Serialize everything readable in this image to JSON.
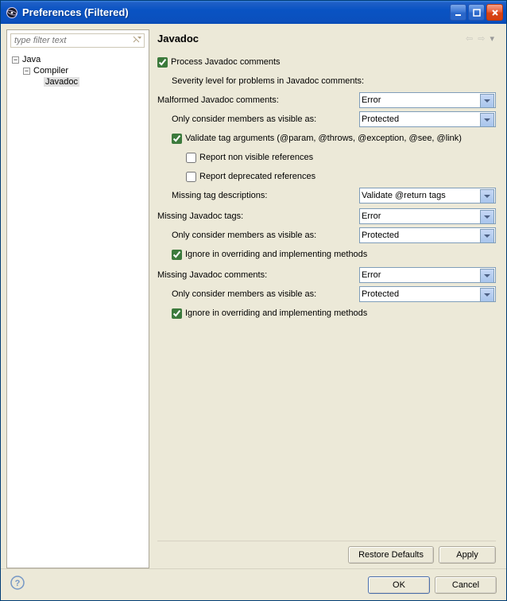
{
  "window": {
    "title": "Preferences (Filtered)"
  },
  "sidebar": {
    "filter_placeholder": "type filter text",
    "tree": {
      "root": "Java",
      "child": "Compiler",
      "leaf": "Javadoc"
    }
  },
  "page": {
    "title": "Javadoc",
    "process_label": "Process Javadoc comments",
    "severity_caption": "Severity level for problems in Javadoc comments:",
    "malformed": {
      "label": "Malformed Javadoc comments:",
      "value": "Error",
      "visibility_label": "Only consider members as visible as:",
      "visibility_value": "Protected",
      "validate_label": "Validate tag arguments (@param, @throws, @exception, @see, @link)",
      "report_nonvisible_label": "Report non visible references",
      "report_deprecated_label": "Report deprecated references",
      "missing_desc_label": "Missing tag descriptions:",
      "missing_desc_value": "Validate @return tags"
    },
    "missing_tags": {
      "label": "Missing Javadoc tags:",
      "value": "Error",
      "visibility_label": "Only consider members as visible as:",
      "visibility_value": "Protected",
      "ignore_label": "Ignore in overriding and implementing methods"
    },
    "missing_comments": {
      "label": "Missing Javadoc comments:",
      "value": "Error",
      "visibility_label": "Only consider members as visible as:",
      "visibility_value": "Protected",
      "ignore_label": "Ignore in overriding and implementing methods"
    },
    "restore_defaults": "Restore Defaults",
    "apply": "Apply"
  },
  "footer": {
    "ok": "OK",
    "cancel": "Cancel"
  }
}
